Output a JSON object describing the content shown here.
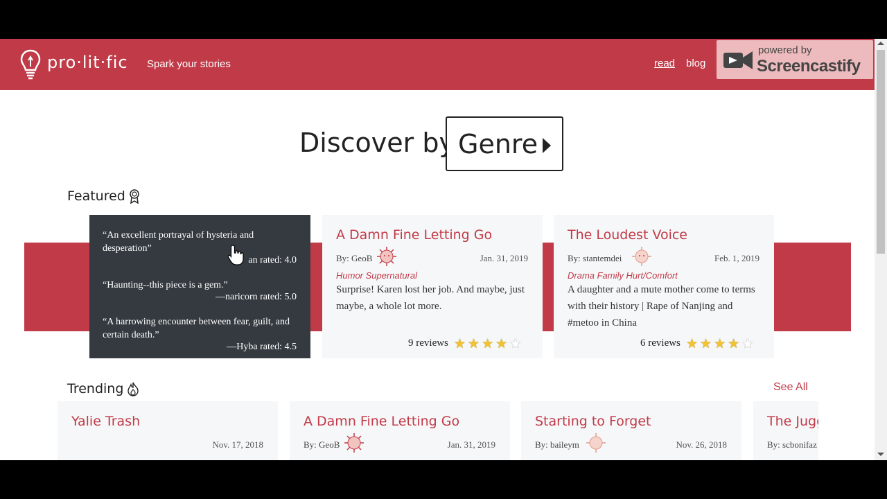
{
  "header": {
    "brand": "pro·lit·fic",
    "tagline": "Spark your stories",
    "nav": [
      {
        "label": "read"
      },
      {
        "label": "blog"
      }
    ],
    "watermark": {
      "small": "powered by",
      "big": "Screencastify"
    }
  },
  "discover": {
    "prefix": "Discover by",
    "genre": "Genre"
  },
  "featured": {
    "title": "Featured",
    "quotes": [
      {
        "text": "“An excellent portrayal of hysteria and desperation”",
        "attribution": "an rated: 4.0"
      },
      {
        "text": "“Haunting--this piece is a gem.”",
        "attribution": "—naricorn rated: 5.0"
      },
      {
        "text": "“A harrowing encounter between fear, guilt, and certain death.”",
        "attribution": "—Hyba rated: 4.5"
      }
    ],
    "cards": [
      {
        "title": "A Damn Fine Letting Go",
        "author": "By: GeoB",
        "date": "Jan. 31, 2019",
        "genres": "Humor Supernatural",
        "description": "Surprise! Karen lost her job. And maybe, just maybe, a whole lot more.",
        "reviews": "9 reviews",
        "rating": 4
      },
      {
        "title": "The Loudest Voice",
        "author": "By: stantemdei",
        "date": "Feb. 1, 2019",
        "genres": "Drama Family Hurt/Comfort",
        "description": "A daughter and a mute mother come to terms with their history | Rape of Nanjing and #metoo in China",
        "reviews": "6 reviews",
        "rating": 4
      }
    ]
  },
  "trending": {
    "title": "Trending",
    "see_all": "See All",
    "cards": [
      {
        "title": "Yalie Trash",
        "author": "",
        "date": "Nov. 17, 2018"
      },
      {
        "title": "A Damn Fine Letting Go",
        "author": "By: GeoB",
        "date": "Jan. 31, 2019"
      },
      {
        "title": "Starting to Forget",
        "author": "By: baileym",
        "date": "Nov. 26, 2018"
      },
      {
        "title": "The Jugg",
        "author": "By: scbonifaz",
        "date": ""
      }
    ]
  },
  "colors": {
    "accent": "#c13a48",
    "dark": "#343a40",
    "card": "#f6f7f8"
  },
  "toolbar": {
    "icons": [
      "pause-icon",
      "pointer-icon",
      "pen-icon",
      "highlighter-icon",
      "camera-icon",
      "timer-icon",
      "close-icon"
    ]
  }
}
